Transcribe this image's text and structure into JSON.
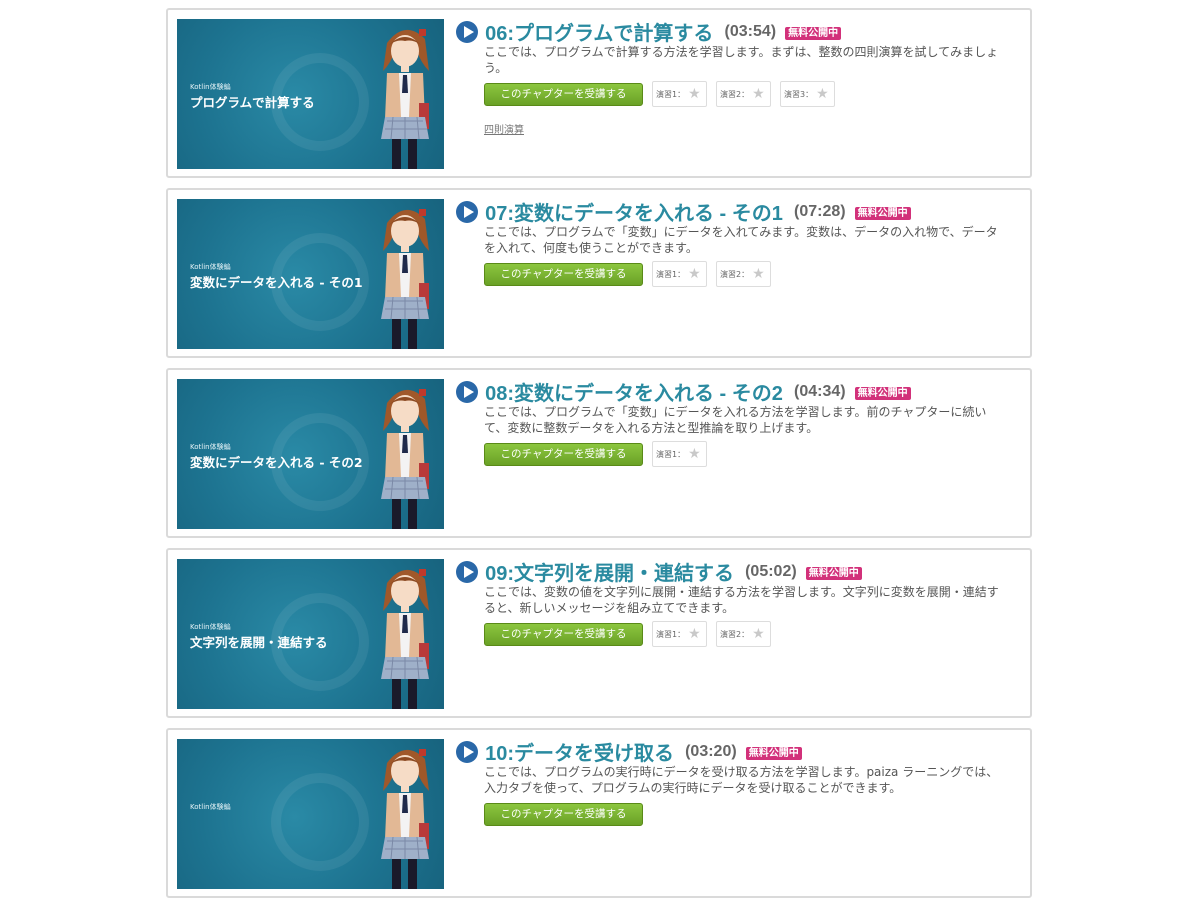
{
  "start_button_label": "このチャプターを受講する",
  "badge_label": "無料公開中",
  "thumb_small_label": "Kotlin体験編",
  "chapters": [
    {
      "title": "06:プログラムで計算する",
      "duration": "(03:54)",
      "description": "ここでは、プログラムで計算する方法を学習します。まずは、整数の四則演算を試してみましょう。",
      "thumb_title": "プログラムで計算する",
      "exercises": [
        "演習1：",
        "演習2：",
        "演習3："
      ],
      "tags": [
        "四則演算"
      ]
    },
    {
      "title": "07:変数にデータを入れる - その1",
      "duration": "(07:28)",
      "description": "ここでは、プログラムで「変数」にデータを入れてみます。変数は、データの入れ物で、データを入れて、何度も使うことができます。",
      "thumb_title": "変数にデータを入れる - その1",
      "exercises": [
        "演習1：",
        "演習2："
      ],
      "tags": []
    },
    {
      "title": "08:変数にデータを入れる - その2",
      "duration": "(04:34)",
      "description": "ここでは、プログラムで「変数」にデータを入れる方法を学習します。前のチャプターに続いて、変数に整数データを入れる方法と型推論を取り上げます。",
      "thumb_title": "変数にデータを入れる - その2",
      "exercises": [
        "演習1："
      ],
      "tags": []
    },
    {
      "title": "09:文字列を展開・連結する",
      "duration": "(05:02)",
      "description": "ここでは、変数の値を文字列に展開・連結する方法を学習します。文字列に変数を展開・連結すると、新しいメッセージを組み立てできます。",
      "thumb_title": "文字列を展開・連結する",
      "exercises": [
        "演習1：",
        "演習2："
      ],
      "tags": []
    },
    {
      "title": "10:データを受け取る",
      "duration": "(03:20)",
      "description": "ここでは、プログラムの実行時にデータを受け取る方法を学習します。paiza ラーニングでは、入力タブを使って、プログラムの実行時にデータを受け取ることができます。",
      "thumb_title": "",
      "exercises": [],
      "tags": []
    }
  ],
  "colors": {
    "title": "#2a8aa0",
    "badge": "#d2317a",
    "button": "#6aa126",
    "thumbnail": "#1d7390"
  },
  "icons": [
    "play-icon",
    "star-icon"
  ]
}
